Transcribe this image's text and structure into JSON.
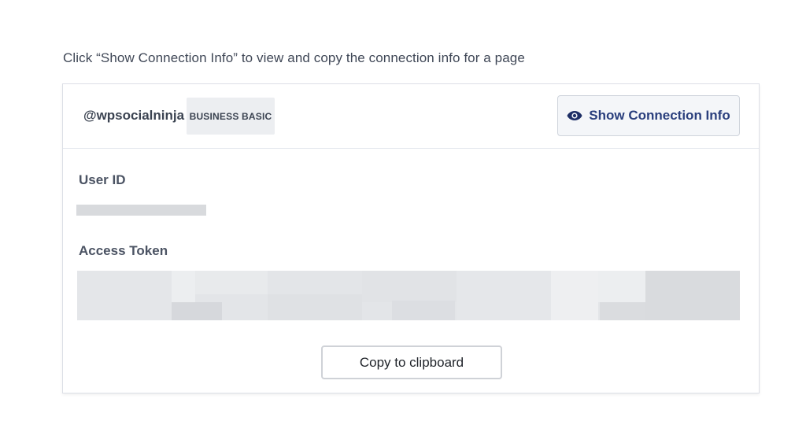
{
  "instruction": "Click “Show Connection Info” to view and copy the connection info for a page",
  "account": {
    "username": "@wpsocialninja",
    "plan_badge": "BUSINESS BASIC"
  },
  "show_button": {
    "label": "Show Connection Info",
    "icon": "eye-icon",
    "color": "#2a3f7d"
  },
  "fields": {
    "user_id_label": "User ID",
    "access_token_label": "Access Token"
  },
  "copy_button": {
    "label": "Copy to clipboard"
  }
}
